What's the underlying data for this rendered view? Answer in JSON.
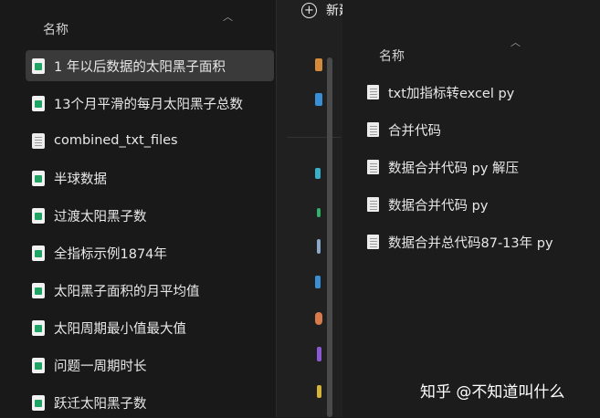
{
  "left_pane": {
    "header": "名称",
    "items": [
      {
        "label": "1 年以后数据的太阳黑子面积",
        "icon": "spreadsheet-icon",
        "selected": true
      },
      {
        "label": "13个月平滑的每月太阳黑子总数",
        "icon": "spreadsheet-icon"
      },
      {
        "label": "combined_txt_files",
        "icon": "text-file-icon"
      },
      {
        "label": "半球数据",
        "icon": "spreadsheet-icon"
      },
      {
        "label": "过渡太阳黑子数",
        "icon": "spreadsheet-icon"
      },
      {
        "label": "全指标示例1874年",
        "icon": "spreadsheet-icon"
      },
      {
        "label": "太阳黑子面积的月平均值",
        "icon": "spreadsheet-icon"
      },
      {
        "label": "太阳周期最小值最大值",
        "icon": "spreadsheet-icon"
      },
      {
        "label": "问题一周期时长",
        "icon": "spreadsheet-icon"
      },
      {
        "label": "跃迁太阳黑子数",
        "icon": "spreadsheet-icon"
      }
    ]
  },
  "toolbar": {
    "new_label": "新建",
    "icons": [
      "cut-icon",
      "copy-icon",
      "paste-icon",
      "rename-icon"
    ]
  },
  "right_pane": {
    "header": "名称",
    "items": [
      {
        "label": "txt加指标转excel py",
        "icon": "text-file-icon"
      },
      {
        "label": "合并代码",
        "icon": "text-file-icon"
      },
      {
        "label": "数据合并代码 py  解压",
        "icon": "text-file-icon"
      },
      {
        "label": "数据合并代码 py",
        "icon": "text-file-icon"
      },
      {
        "label": "数据合并总代码87-13年 py",
        "icon": "text-file-icon"
      }
    ]
  },
  "watermark": "知乎 @不知道叫什么",
  "colors": {
    "background": "#1c1c1c",
    "selected_row": "#3a3a3a",
    "excel_green": "#21a366"
  }
}
